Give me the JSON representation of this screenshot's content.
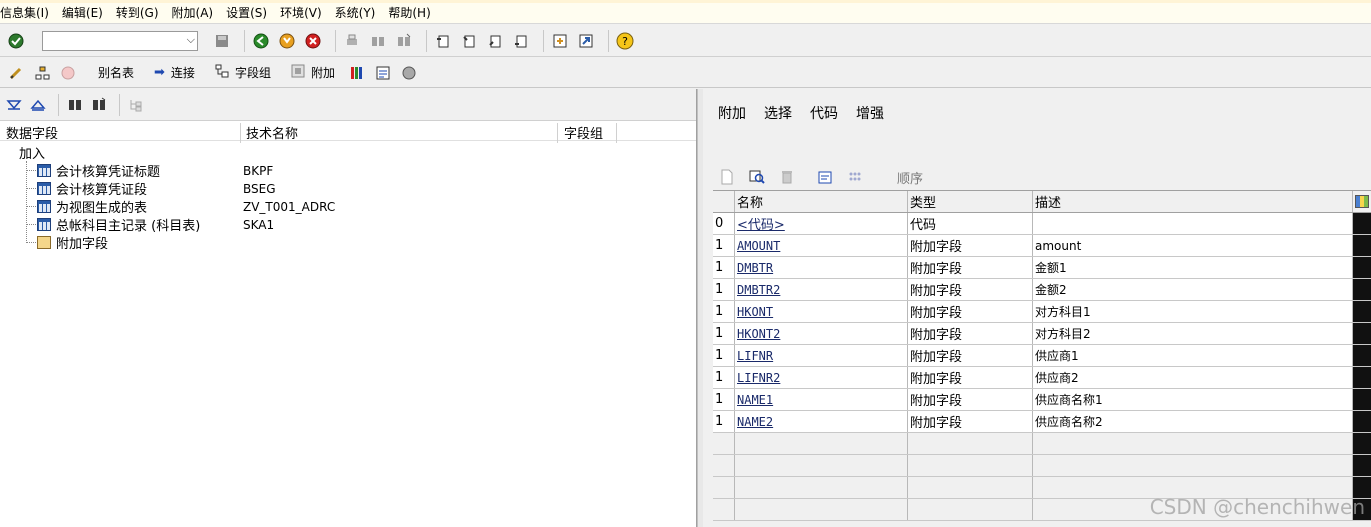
{
  "menubar": [
    "信息集(I)",
    "编辑(E)",
    "转到(G)",
    "附加(A)",
    "设置(S)",
    "环境(V)",
    "系统(Y)",
    "帮助(H)"
  ],
  "toolbar2": {
    "alias": "别名表",
    "join": "连接",
    "fieldgroup": "字段组",
    "extra": "附加"
  },
  "left": {
    "col_field": "数据字段",
    "col_tech": "技术名称",
    "col_group": "字段组",
    "root": "加入",
    "nodes": [
      {
        "label": "会计核算凭证标题",
        "tech": "BKPF",
        "icon": "table-icon"
      },
      {
        "label": "会计核算凭证段",
        "tech": "BSEG",
        "icon": "table-icon"
      },
      {
        "label": "为视图生成的表",
        "tech": "ZV_T001_ADRC",
        "icon": "table-icon"
      },
      {
        "label": "总帐科目主记录 (科目表)",
        "tech": "SKA1",
        "icon": "table-icon"
      },
      {
        "label": "附加字段",
        "tech": "",
        "icon": "additional-field-icon"
      }
    ]
  },
  "right": {
    "menu": [
      "附加",
      "选择",
      "代码",
      "增强"
    ],
    "toolbar_order": "顺序",
    "headers": {
      "name": "名称",
      "type": "类型",
      "desc": "描述"
    },
    "rows": [
      {
        "num": "0",
        "name": "<代码>",
        "type": "代码",
        "desc": ""
      },
      {
        "num": "1",
        "name": "AMOUNT",
        "type": "附加字段",
        "desc": "amount"
      },
      {
        "num": "1",
        "name": "DMBTR",
        "type": "附加字段",
        "desc": "金额1"
      },
      {
        "num": "1",
        "name": "DMBTR2",
        "type": "附加字段",
        "desc": "金额2"
      },
      {
        "num": "1",
        "name": "HKONT",
        "type": "附加字段",
        "desc": "对方科目1"
      },
      {
        "num": "1",
        "name": "HKONT2",
        "type": "附加字段",
        "desc": "对方科目2"
      },
      {
        "num": "1",
        "name": "LIFNR",
        "type": "附加字段",
        "desc": "供应商1"
      },
      {
        "num": "1",
        "name": "LIFNR2",
        "type": "附加字段",
        "desc": "供应商2"
      },
      {
        "num": "1",
        "name": "NAME1",
        "type": "附加字段",
        "desc": "供应商名称1"
      },
      {
        "num": "1",
        "name": "NAME2",
        "type": "附加字段",
        "desc": "供应商名称2"
      }
    ]
  },
  "watermark": "CSDN @chenchihwen"
}
